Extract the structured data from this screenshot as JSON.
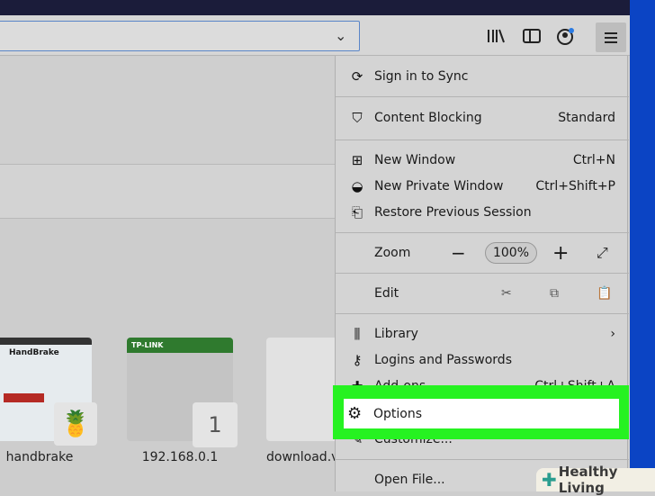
{
  "menu": {
    "sync": "Sign in to Sync",
    "content_blocking": "Content Blocking",
    "content_blocking_value": "Standard",
    "new_window": "New Window",
    "new_window_sc": "Ctrl+N",
    "private_window": "New Private Window",
    "private_window_sc": "Ctrl+Shift+P",
    "restore": "Restore Previous Session",
    "zoom": "Zoom",
    "zoom_minus": "−",
    "zoom_value": "100%",
    "zoom_plus": "+",
    "edit": "Edit",
    "library": "Library",
    "logins": "Logins and Passwords",
    "addons": "Add-ons",
    "addons_sc": "Ctrl+Shift+A",
    "options": "Options",
    "customize": "Customize...",
    "open_file": "Open File..."
  },
  "tiles": [
    {
      "label": "handbrake",
      "title": "HandBrake"
    },
    {
      "label": "192.168.0.1",
      "title": "TP-LINK",
      "badge": "1"
    },
    {
      "label": "download.vi"
    }
  ],
  "watermark": "Healthy Living",
  "colors": {
    "highlight": "#26f221",
    "menu_bg": "#d4d4d4",
    "accent": "#0b44c4"
  }
}
